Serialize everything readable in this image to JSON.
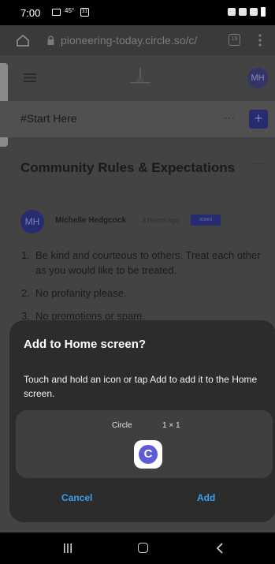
{
  "status_bar": {
    "time": "7:00",
    "temperature": "45°",
    "calendar_day": "31"
  },
  "browser": {
    "url": "pioneering-today.circle.so/c/",
    "tab_count": "19"
  },
  "header": {
    "avatar_initials": "MH"
  },
  "channel": {
    "title": "#Start Here",
    "more": "···",
    "add": "+"
  },
  "post": {
    "title": "Community Rules & Expectations",
    "more": "···",
    "author_initials": "MH",
    "author_name": "Michelle Hedgcock",
    "time": "3 hours ago",
    "role": "ADMIN",
    "rules": [
      {
        "num": "1.",
        "text": "Be kind and courteous to others. Treat each other as you would like to be treated."
      },
      {
        "num": "2.",
        "text": "No profanity please."
      },
      {
        "num": "3.",
        "text": "No promotions or spam."
      }
    ]
  },
  "dialog": {
    "title": "Add to Home screen?",
    "body": "Touch and hold an icon or tap Add to add it to the Home screen.",
    "app_name": "Circle",
    "app_size": "1 × 1",
    "app_letter": "C",
    "cancel": "Cancel",
    "add": "Add"
  },
  "colors": {
    "accent_blue": "#37a0f2",
    "brand_indigo": "#272b70",
    "app_icon": "#5d5bd8",
    "dialog_bg": "#2c2c2c"
  },
  "icons": [
    "home-icon",
    "lock-icon",
    "tabs-icon",
    "more-vert-icon",
    "hamburger-icon",
    "recent-apps-icon",
    "nav-home-icon",
    "nav-back-icon"
  ]
}
